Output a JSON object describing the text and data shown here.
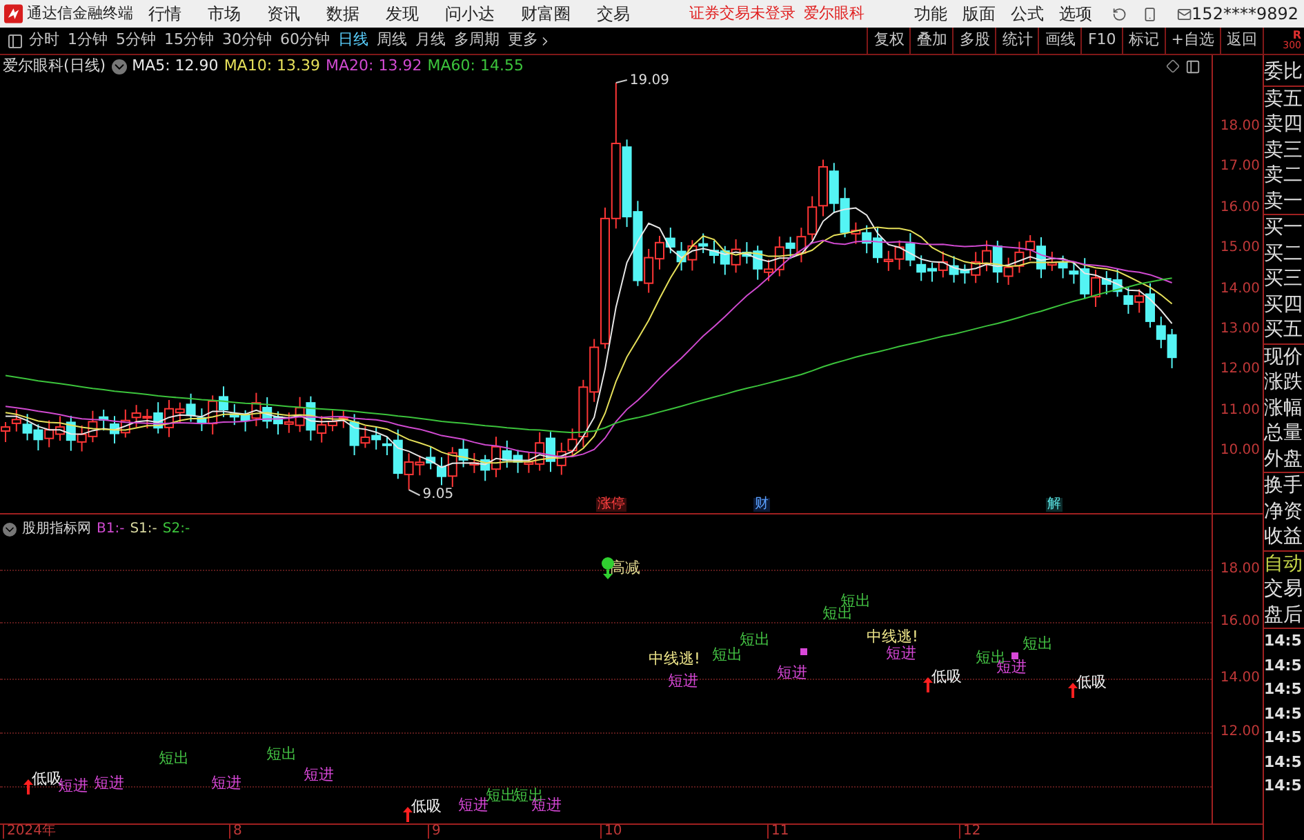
{
  "app": {
    "title": "通达信金融终端"
  },
  "menu": [
    "行情",
    "市场",
    "资讯",
    "数据",
    "发现",
    "问小达",
    "财富圈",
    "交易"
  ],
  "status": {
    "login": "证券交易未登录",
    "stock": "爱尔眼科"
  },
  "right_menu": [
    "功能",
    "版面",
    "公式",
    "选项"
  ],
  "account": "152****9892",
  "periods": [
    {
      "label": "分时",
      "selected": false
    },
    {
      "label": "1分钟",
      "selected": false
    },
    {
      "label": "5分钟",
      "selected": false
    },
    {
      "label": "15分钟",
      "selected": false
    },
    {
      "label": "30分钟",
      "selected": false
    },
    {
      "label": "60分钟",
      "selected": false
    },
    {
      "label": "日线",
      "selected": true
    },
    {
      "label": "周线",
      "selected": false
    },
    {
      "label": "月线",
      "selected": false
    },
    {
      "label": "多周期",
      "selected": false
    },
    {
      "label": "更多",
      "selected": false
    }
  ],
  "tools": [
    "复权",
    "叠加",
    "多股",
    "统计",
    "画线",
    "F10",
    "标记",
    "+自选",
    "返回"
  ],
  "corner": [
    "R",
    "300"
  ],
  "chart": {
    "name": "爱尔眼科(日线)",
    "ma": [
      {
        "label": "MA5: 12.90",
        "color": "#e8e8e8"
      },
      {
        "label": "MA10: 13.39",
        "color": "#e6e05a"
      },
      {
        "label": "MA20: 13.92",
        "color": "#d04ad0"
      },
      {
        "label": "MA60: 14.55",
        "color": "#3cc43c"
      }
    ],
    "high_label": "19.09",
    "low_label": "9.05",
    "events": [
      {
        "text": "涨停",
        "kind": "limit"
      },
      {
        "text": "财",
        "kind": "finance"
      },
      {
        "text": "解",
        "kind": "unlock"
      }
    ],
    "yticks": [
      "18.00",
      "17.00",
      "16.00",
      "15.00",
      "14.00",
      "13.00",
      "12.00",
      "11.00",
      "10.00"
    ]
  },
  "indicator": {
    "name": "股朋指标网",
    "values": [
      {
        "label": "B1:-",
        "color": "#d04ad0"
      },
      {
        "label": "S1:-",
        "color": "#d8d8a0"
      },
      {
        "label": "S2:-",
        "color": "#3cc43c"
      }
    ],
    "yticks": [
      "18.00",
      "16.00",
      "14.00",
      "12.00"
    ],
    "signals": [
      {
        "text": "低吸",
        "kind": "low"
      },
      {
        "text": "短进",
        "kind": "buy"
      },
      {
        "text": "短进",
        "kind": "buy"
      },
      {
        "text": "短出",
        "kind": "sell"
      },
      {
        "text": "短进",
        "kind": "buy"
      },
      {
        "text": "短出",
        "kind": "sell"
      },
      {
        "text": "短进",
        "kind": "buy"
      },
      {
        "text": "低吸",
        "kind": "low"
      },
      {
        "text": "短进",
        "kind": "buy"
      },
      {
        "text": "短出",
        "kind": "sell"
      },
      {
        "text": "短出",
        "kind": "sell"
      },
      {
        "text": "短进",
        "kind": "buy"
      },
      {
        "text": "高减",
        "kind": "reduce"
      },
      {
        "text": "中线逃!",
        "kind": "escape"
      },
      {
        "text": "短进",
        "kind": "buy"
      },
      {
        "text": "短出",
        "kind": "sell"
      },
      {
        "text": "短出",
        "kind": "sell"
      },
      {
        "text": "短进",
        "kind": "buy"
      },
      {
        "text": "短出",
        "kind": "sell"
      },
      {
        "text": "短出",
        "kind": "sell"
      },
      {
        "text": "中线逃!",
        "kind": "escape"
      },
      {
        "text": "短进",
        "kind": "buy"
      },
      {
        "text": "低吸",
        "kind": "low"
      },
      {
        "text": "短出",
        "kind": "sell"
      },
      {
        "text": "短进",
        "kind": "buy"
      },
      {
        "text": "短出",
        "kind": "sell"
      },
      {
        "text": "低吸",
        "kind": "low"
      }
    ]
  },
  "xaxis": [
    "2024年",
    "8",
    "9",
    "10",
    "11",
    "12"
  ],
  "quote_panel": [
    {
      "kind": "field",
      "items": [
        {
          "text": "委比",
          "selected": false
        }
      ]
    },
    {
      "kind": "field",
      "items": [
        {
          "text": "卖五",
          "selected": false
        },
        {
          "text": "卖四",
          "selected": false
        },
        {
          "text": "卖三",
          "selected": false
        },
        {
          "text": "卖二",
          "selected": false
        },
        {
          "text": "卖一",
          "selected": false
        }
      ]
    },
    {
      "kind": "field",
      "items": [
        {
          "text": "买一",
          "selected": false
        },
        {
          "text": "买二",
          "selected": false
        },
        {
          "text": "买三",
          "selected": false
        },
        {
          "text": "买四",
          "selected": false
        },
        {
          "text": "买五",
          "selected": false
        }
      ]
    },
    {
      "kind": "field",
      "items": [
        {
          "text": "现价",
          "selected": false
        },
        {
          "text": "涨跌",
          "selected": false
        },
        {
          "text": "涨幅",
          "selected": false
        },
        {
          "text": "总量",
          "selected": false
        },
        {
          "text": "外盘",
          "selected": false
        }
      ]
    },
    {
      "kind": "field",
      "items": [
        {
          "text": "换手",
          "selected": false
        },
        {
          "text": "净资",
          "selected": false
        },
        {
          "text": "收益",
          "selected": false
        }
      ]
    },
    {
      "kind": "field",
      "items": [
        {
          "text": "自动",
          "selected": true
        },
        {
          "text": "交易",
          "selected": false
        },
        {
          "text": "盘后",
          "selected": false
        }
      ]
    },
    {
      "kind": "time",
      "items": [
        {
          "text": "14:5",
          "selected": false
        },
        {
          "text": "14:5",
          "selected": false
        },
        {
          "text": "14:5",
          "selected": false
        },
        {
          "text": "14:5",
          "selected": false
        },
        {
          "text": "14:5",
          "selected": false
        },
        {
          "text": "14:5",
          "selected": false
        },
        {
          "text": "14:5",
          "selected": false
        }
      ]
    }
  ]
}
